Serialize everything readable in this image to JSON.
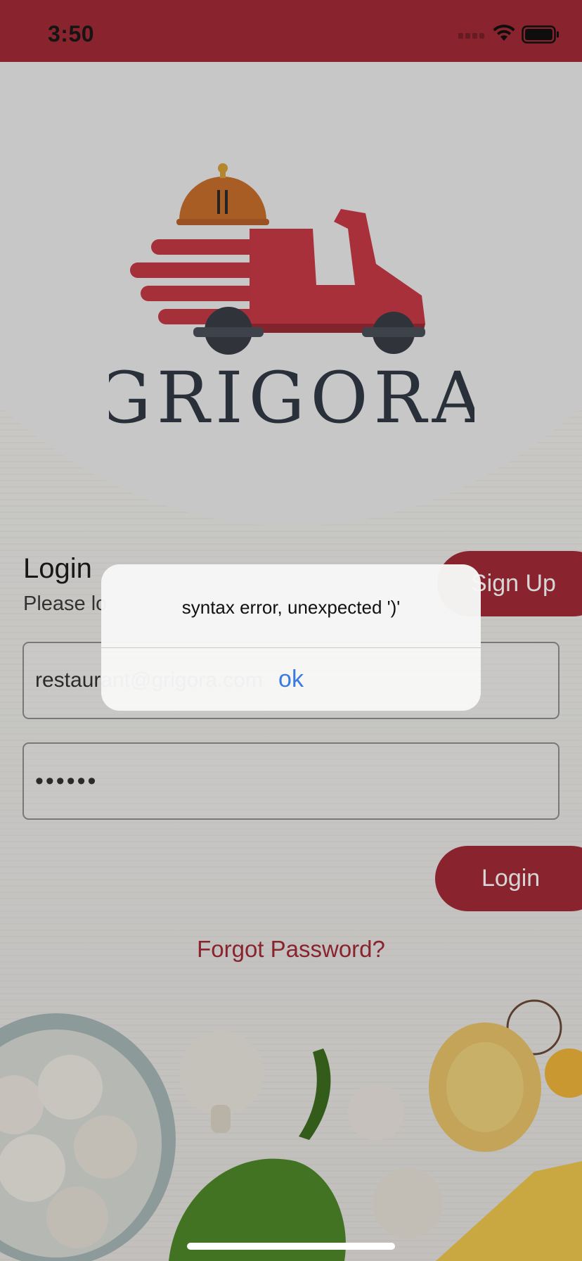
{
  "status_bar": {
    "time": "3:50"
  },
  "colors": {
    "brand": "#a42b37",
    "link": "#3c7ae0"
  },
  "logo": {
    "wordmark": "GRIGORA"
  },
  "login": {
    "heading": "Login",
    "subheading": "Please lo",
    "signup_label": "Sign Up",
    "email_value": "restaurant@grigora.com",
    "password_value": "••••••",
    "login_label": "Login",
    "forgot_label": "Forgot Password?"
  },
  "alert": {
    "message": "syntax error, unexpected ')'",
    "ok_label": "ok"
  },
  "icons": [
    "signal-icon",
    "wifi-icon",
    "battery-icon"
  ]
}
